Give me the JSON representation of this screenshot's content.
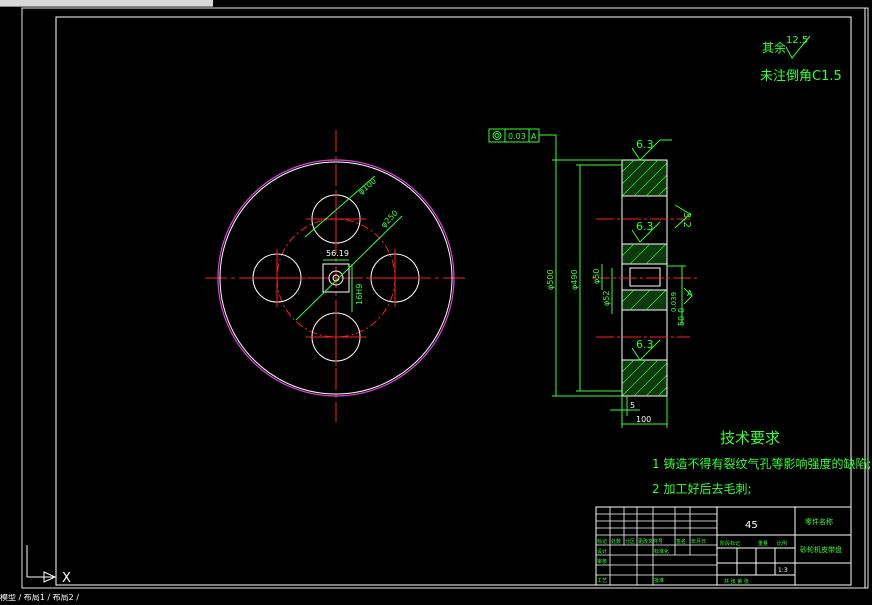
{
  "notes": {
    "surface_roughness_rest": "其余",
    "roughness_value_general": "12.5",
    "chamfer_note": "未注倒角C1.5"
  },
  "tolerance_frame": {
    "value": "0.03",
    "datum": "A"
  },
  "front_view_dims": {
    "hole_dia": "φ100",
    "pitch_circle": "φ250",
    "keyway_width": "56.19",
    "bore_dim": "16H9"
  },
  "section_view_dims": {
    "roughness_top": "6.3",
    "roughness_mid": "6.3",
    "roughness_low": "6.3",
    "roughness_side": "3.2",
    "outer_dia": "φ500",
    "inner_dia": "φ490",
    "hub_dia": "φ50",
    "shaft_dia": "φ52",
    "key_tol": "0.039",
    "key_size": "50-0",
    "datum_label": "A",
    "small_width": "5",
    "total_width": "100"
  },
  "tech_requirements": {
    "title": "技术要求",
    "item1": "1 铸造不得有裂纹气孔等影响强度的缺陷;",
    "item2": "2 加工好后去毛刺;"
  },
  "title_block": {
    "material": "45",
    "company": "零件名称",
    "part_name": "砂轮机皮带盘",
    "scale": "1:3",
    "row_labels": [
      "标记",
      "处数",
      "分区",
      "更改文件号",
      "签名",
      "年月日"
    ],
    "designer": "设计",
    "standardize": "标准化",
    "reviewer": "审核",
    "process": "工艺",
    "approve": "批准",
    "stage_mark": "阶段标记",
    "weight": "重量",
    "ratio": "比例",
    "sheets": "共  张  第  张"
  },
  "ucs": {
    "x_label": "X"
  },
  "status_bar": {
    "text": "模型 / 布局1 / 布局2 /"
  }
}
